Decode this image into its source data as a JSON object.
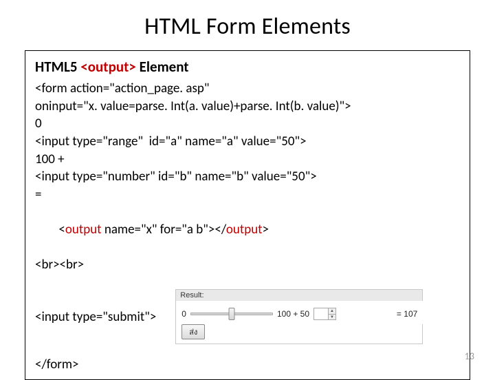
{
  "title": "HTML Form Elements",
  "section": {
    "prefix": "HTML5 ",
    "tag": "<output>",
    "suffix": " Element"
  },
  "code": {
    "l1": "<form action=\"action_page. asp\"",
    "l2": "oninput=\"x. value=parse. Int(a. value)+parse. Int(b. value)\">",
    "l3": "0",
    "l4": "<input type=\"range\"  id=\"a\" name=\"a\" value=\"50\">",
    "l5": "100 +",
    "l6": "<input type=\"number\" id=\"b\" name=\"b\" value=\"50\">",
    "l7": "=",
    "l8a": "<",
    "l8b": "output",
    "l8c": " name=\"x\" for=\"a b\"></",
    "l8d": "output",
    "l8e": ">",
    "l9": "<br><br>",
    "submit_line": "<input type=\"submit\">",
    "close": "</form>"
  },
  "demo": {
    "header": "Result:",
    "left_val": "0",
    "mid_text": "100 + 50",
    "num_value": "",
    "result": "= 107",
    "submit_label": "ส่ง"
  },
  "page_number": "13"
}
